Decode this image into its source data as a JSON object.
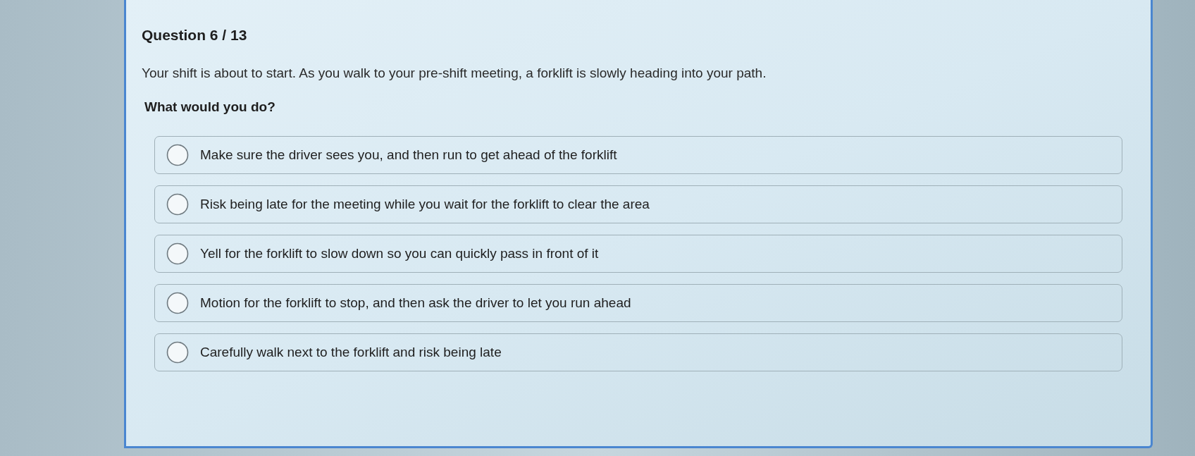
{
  "question": {
    "counter": "Question 6 / 13",
    "text": "Your shift is about to start. As you walk to your pre-shift meeting, a forklift is slowly heading into your path.",
    "prompt": "What would you do?"
  },
  "options": [
    {
      "label": "Make sure the driver sees you, and then run to get ahead of the forklift",
      "selected": false
    },
    {
      "label": "Risk being late for the meeting while you wait for the forklift to clear the area",
      "selected": false
    },
    {
      "label": "Yell for the forklift to slow down so you can quickly pass in front of it",
      "selected": false
    },
    {
      "label": "Motion for the forklift to stop, and then ask the driver to let you run ahead",
      "selected": false
    },
    {
      "label": "Carefully walk next to the forklift and risk being late",
      "selected": false
    }
  ]
}
